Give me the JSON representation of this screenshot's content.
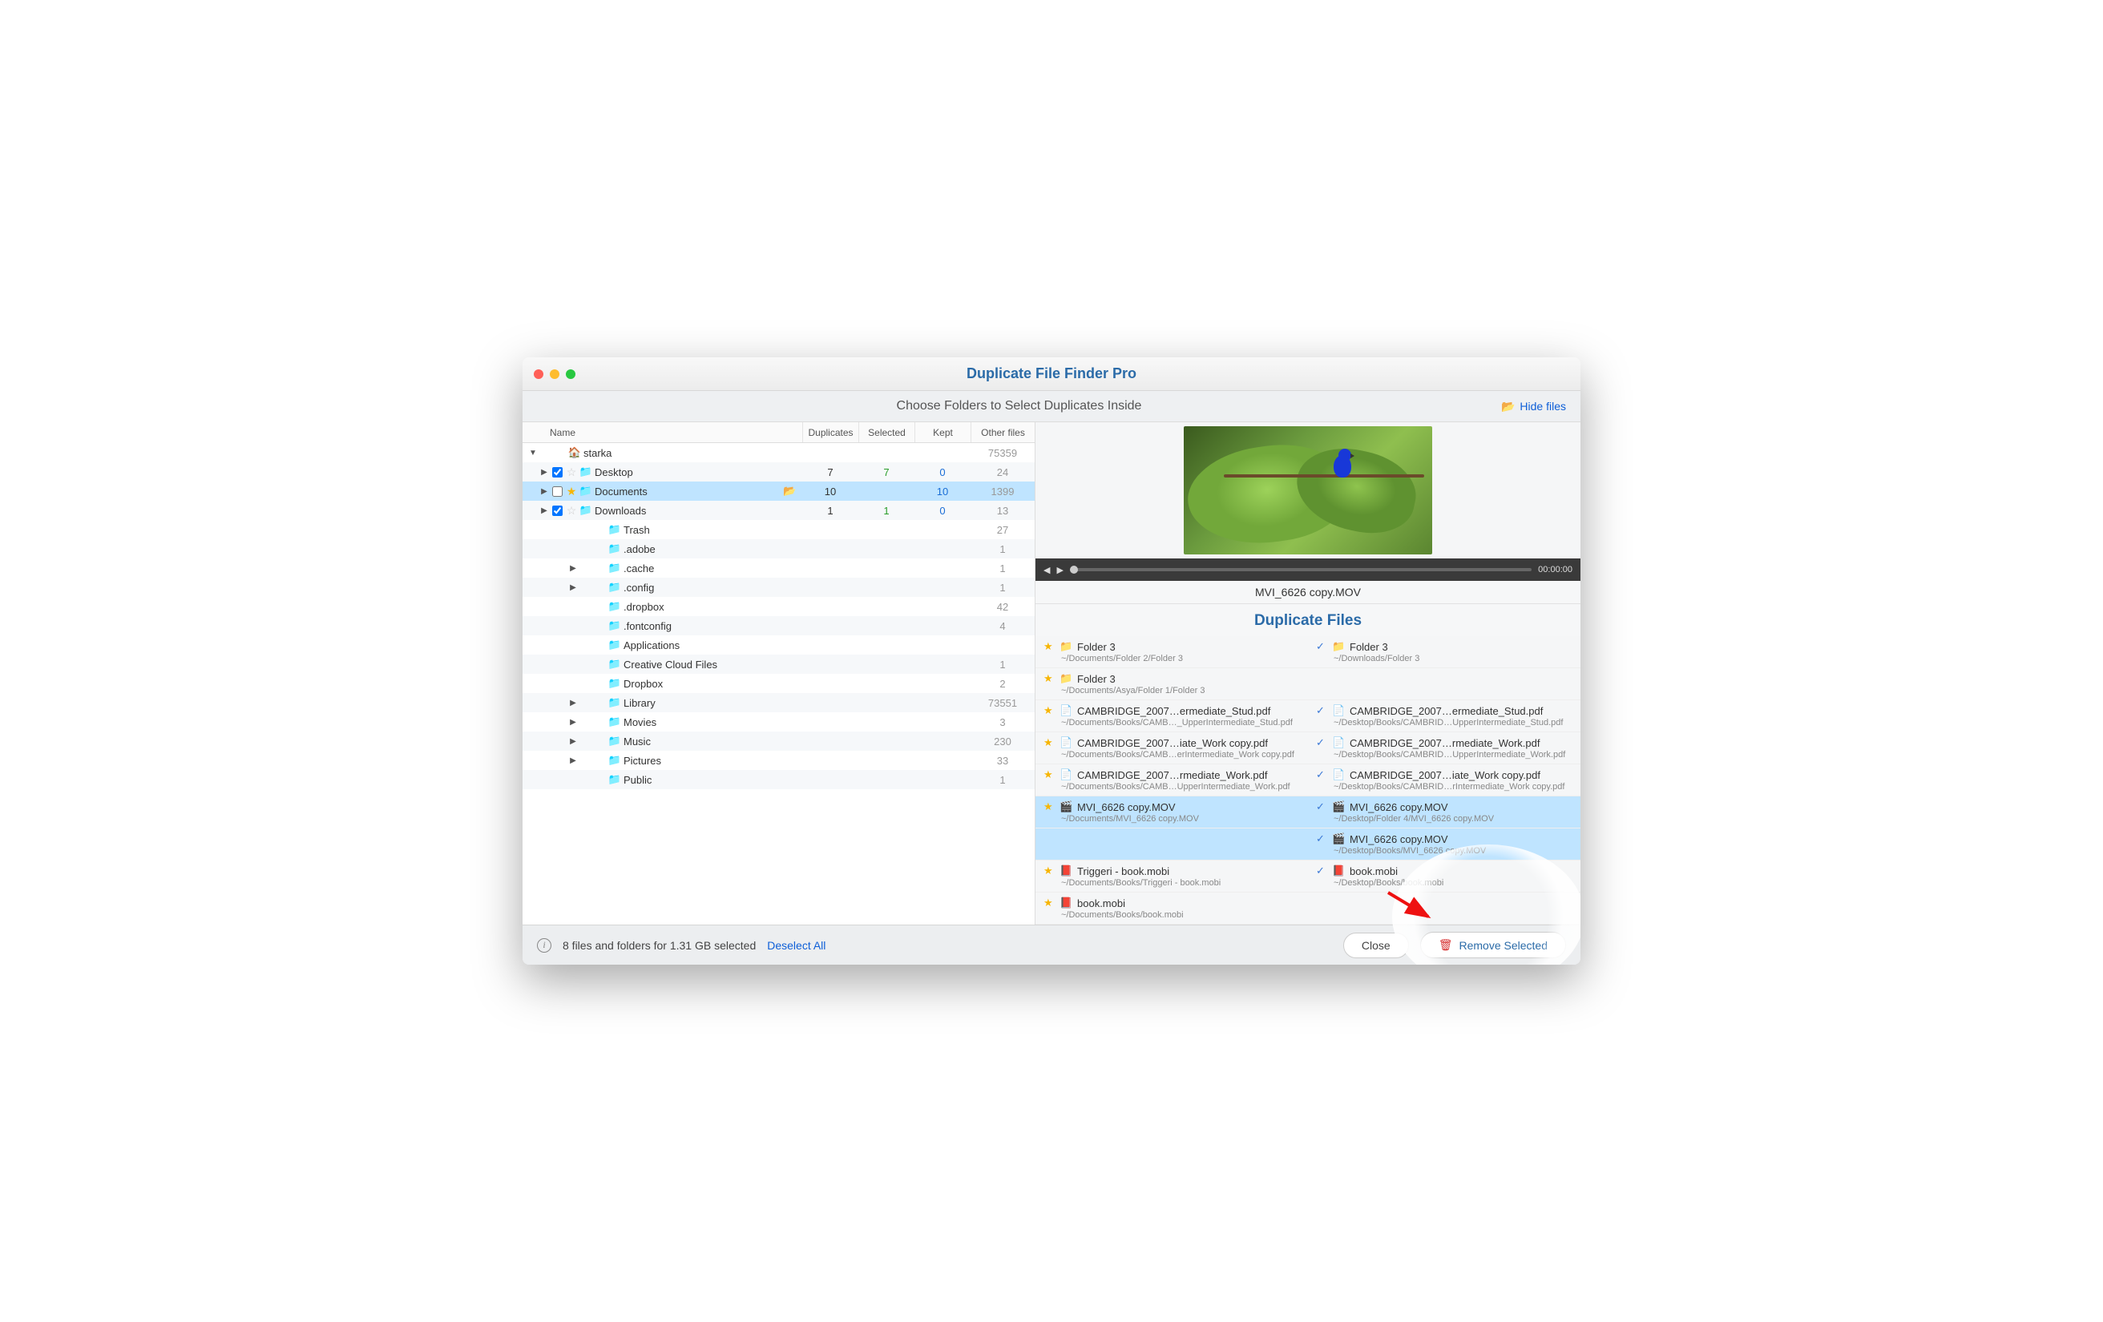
{
  "title": "Duplicate File Finder Pro",
  "subtitle": "Choose Folders to Select Duplicates Inside",
  "hide_files": "Hide files",
  "columns": {
    "name": "Name",
    "duplicates": "Duplicates",
    "selected": "Selected",
    "kept": "Kept",
    "other": "Other files"
  },
  "root": {
    "name": "starka",
    "other": "75359"
  },
  "rows": [
    {
      "depth": 1,
      "arrow": "▶",
      "chk": true,
      "star": false,
      "name": "Desktop",
      "dup": "7",
      "sel": "7",
      "kept": "0",
      "other": "24"
    },
    {
      "depth": 1,
      "arrow": "▶",
      "chk": false,
      "star": true,
      "name": "Documents",
      "open": true,
      "dup": "10",
      "sel": "",
      "kept": "10",
      "other": "1399",
      "hl": true
    },
    {
      "depth": 1,
      "arrow": "▶",
      "chk": true,
      "star": false,
      "name": "Downloads",
      "dup": "1",
      "sel": "1",
      "kept": "0",
      "other": "13"
    },
    {
      "depth": 2,
      "name": "Trash",
      "other": "27"
    },
    {
      "depth": 2,
      "name": ".adobe",
      "other": "1"
    },
    {
      "depth": 2,
      "arrow": "▶",
      "name": ".cache",
      "other": "1"
    },
    {
      "depth": 2,
      "arrow": "▶",
      "name": ".config",
      "other": "1"
    },
    {
      "depth": 2,
      "name": ".dropbox",
      "other": "42"
    },
    {
      "depth": 2,
      "name": ".fontconfig",
      "other": "4"
    },
    {
      "depth": 2,
      "name": "Applications"
    },
    {
      "depth": 2,
      "name": "Creative Cloud Files",
      "other": "1"
    },
    {
      "depth": 2,
      "name": "Dropbox",
      "other": "2"
    },
    {
      "depth": 2,
      "arrow": "▶",
      "name": "Library",
      "other": "73551"
    },
    {
      "depth": 2,
      "arrow": "▶",
      "name": "Movies",
      "other": "3"
    },
    {
      "depth": 2,
      "arrow": "▶",
      "name": "Music",
      "other": "230"
    },
    {
      "depth": 2,
      "arrow": "▶",
      "name": "Pictures",
      "other": "33"
    },
    {
      "depth": 2,
      "name": "Public",
      "other": "1"
    }
  ],
  "preview": {
    "filename": "MVI_6626 copy.MOV",
    "time": "00:00:00"
  },
  "dup_title": "Duplicate Files",
  "dups": [
    {
      "l": {
        "mark": "star",
        "ico": "📁",
        "name": "Folder 3",
        "path": "~/Documents/Folder 2/Folder 3"
      },
      "r": {
        "mark": "check",
        "ico": "📁",
        "name": "Folder 3",
        "path": "~/Downloads/Folder 3"
      }
    },
    {
      "l": {
        "mark": "star",
        "ico": "📁",
        "name": "Folder 3",
        "path": "~/Documents/Asya/Folder 1/Folder 3"
      }
    },
    {
      "l": {
        "mark": "star",
        "ico": "📄",
        "name": "CAMBRIDGE_2007…ermediate_Stud.pdf",
        "path": "~/Documents/Books/CAMB…_UpperIntermediate_Stud.pdf"
      },
      "r": {
        "mark": "check",
        "ico": "📄",
        "name": "CAMBRIDGE_2007…ermediate_Stud.pdf",
        "path": "~/Desktop/Books/CAMBRID…UpperIntermediate_Stud.pdf"
      }
    },
    {
      "l": {
        "mark": "star",
        "ico": "📄",
        "name": "CAMBRIDGE_2007…iate_Work copy.pdf",
        "path": "~/Documents/Books/CAMB…erIntermediate_Work copy.pdf"
      },
      "r": {
        "mark": "check",
        "ico": "📄",
        "name": "CAMBRIDGE_2007…rmediate_Work.pdf",
        "path": "~/Desktop/Books/CAMBRID…UpperIntermediate_Work.pdf"
      }
    },
    {
      "l": {
        "mark": "star",
        "ico": "📄",
        "name": "CAMBRIDGE_2007…rmediate_Work.pdf",
        "path": "~/Documents/Books/CAMB…UpperIntermediate_Work.pdf"
      },
      "r": {
        "mark": "check",
        "ico": "📄",
        "name": "CAMBRIDGE_2007…iate_Work copy.pdf",
        "path": "~/Desktop/Books/CAMBRID…rIntermediate_Work copy.pdf"
      }
    },
    {
      "hl": true,
      "l": {
        "mark": "star",
        "ico": "🎬",
        "name": "MVI_6626 copy.MOV",
        "path": "~/Documents/MVI_6626 copy.MOV"
      },
      "r": {
        "mark": "check",
        "ico": "🎬",
        "name": "MVI_6626 copy.MOV",
        "path": "~/Desktop/Folder 4/MVI_6626 copy.MOV"
      }
    },
    {
      "hl": true,
      "r": {
        "mark": "check",
        "ico": "🎬",
        "name": "MVI_6626 copy.MOV",
        "path": "~/Desktop/Books/MVI_6626 copy.MOV"
      }
    },
    {
      "l": {
        "mark": "star",
        "ico": "📕",
        "name": "Triggeri - book.mobi",
        "path": "~/Documents/Books/Triggeri - book.mobi"
      },
      "r": {
        "mark": "check",
        "ico": "📕",
        "name": "book.mobi",
        "path": "~/Desktop/Books/book.mobi"
      }
    },
    {
      "l": {
        "mark": "star",
        "ico": "📕",
        "name": "book.mobi",
        "path": "~/Documents/Books/book.mobi"
      }
    }
  ],
  "footer": {
    "status": "8 files and folders for 1.31 GB selected",
    "deselect": "Deselect All",
    "close": "Close",
    "remove": "Remove Selected"
  }
}
